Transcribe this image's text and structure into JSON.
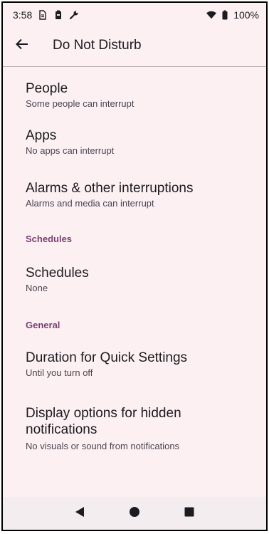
{
  "status_bar": {
    "time": "3:58",
    "battery": "100%",
    "icons": [
      "sim-icon",
      "battery-saver-icon",
      "wrench-icon",
      "wifi-icon",
      "battery-icon"
    ]
  },
  "app_bar": {
    "title": "Do Not Disturb",
    "back_icon": "arrow-back-icon"
  },
  "items": {
    "people": {
      "title": "People",
      "subtitle": "Some people can interrupt"
    },
    "apps": {
      "title": "Apps",
      "subtitle": "No apps can interrupt"
    },
    "alarms": {
      "title": "Alarms & other interruptions",
      "subtitle": "Alarms and media can interrupt"
    },
    "schedules": {
      "title": "Schedules",
      "subtitle": "None"
    },
    "duration": {
      "title": "Duration for Quick Settings",
      "subtitle": "Until you turn off"
    },
    "display": {
      "title": "Display options for hidden notifications",
      "subtitle": "No visuals or sound from notifications"
    }
  },
  "sections": {
    "schedules": "Schedules",
    "general": "General"
  },
  "colors": {
    "background": "#fcf0f3",
    "section_header": "#7a3f72",
    "text_primary": "#1c1b1f",
    "text_secondary": "#49454f"
  },
  "nav_bar": {
    "icons": [
      "back-triangle-icon",
      "home-circle-icon",
      "recents-square-icon"
    ]
  }
}
